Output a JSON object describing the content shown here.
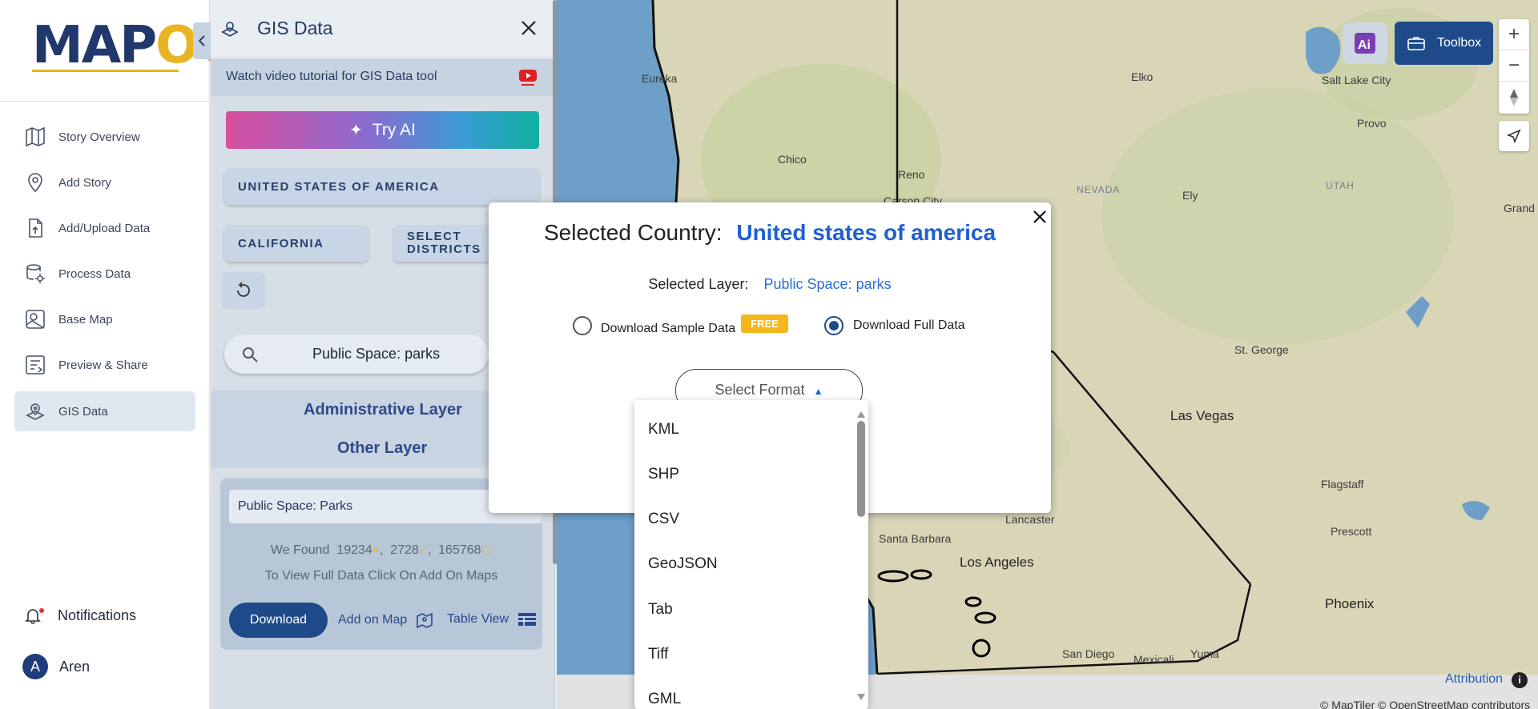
{
  "logo": {
    "text_main": "MAP",
    "text_accent": "OG"
  },
  "nav": {
    "items": [
      {
        "label": "Story Overview",
        "icon": "map-book-icon"
      },
      {
        "label": "Add Story",
        "icon": "location-pin-icon"
      },
      {
        "label": "Add/Upload Data",
        "icon": "file-upload-icon"
      },
      {
        "label": "Process Data",
        "icon": "process-gear-icon"
      },
      {
        "label": "Base Map",
        "icon": "base-map-icon"
      },
      {
        "label": "Preview & Share",
        "icon": "preview-share-icon"
      },
      {
        "label": "GIS Data",
        "icon": "gis-data-icon"
      }
    ],
    "active": "GIS Data",
    "notifications_label": "Notifications",
    "user_initial": "A",
    "user_name": "Aren"
  },
  "gis_panel": {
    "title": "GIS Data",
    "tutorial_text": "Watch video tutorial for GIS Data tool",
    "try_ai_label": "Try AI",
    "country_btn": "UNITED STATES OF AMERICA",
    "state_btn": "CALIFORNIA",
    "districts_btn_line1": "SELECT",
    "districts_btn_line2": "DISTRICTS",
    "search_value": "Public Space: parks",
    "admin_layer_label": "Administrative Layer",
    "other_layer_label": "Other Layer",
    "card": {
      "name": "Public Space: Parks",
      "found_prefix": "We Found",
      "count_points": "19234",
      "count_lines": "2728",
      "count_polygons": "165768",
      "info": "To View Full Data Click On Add On Maps",
      "download_label": "Download",
      "add_map_label": "Add on Map",
      "table_view_label": "Table View"
    }
  },
  "map": {
    "cities": {
      "eureka": "Eureka",
      "chico": "Chico",
      "reno": "Reno",
      "carson": "Carson City",
      "elko": "Elko",
      "slc": "Salt Lake City",
      "provo": "Provo",
      "ely": "Ely",
      "grand": "Grand",
      "stgeorge": "St. George",
      "lasvegas": "Las Vegas",
      "flagstaff": "Flagstaff",
      "lancaster": "Lancaster",
      "santabarbara": "Santa Barbara",
      "losangeles": "Los Angeles",
      "prescott": "Prescott",
      "phoenix": "Phoenix",
      "sandiego": "San Diego",
      "mexicali": "Mexicali",
      "yuma": "Yuma"
    },
    "states": {
      "nevada": "NEVADA",
      "utah": "UTAH"
    },
    "toolbox_label": "Toolbox",
    "zoom_in": "+",
    "zoom_out": "−",
    "attribution": "Attribution",
    "copyright": "© MapTiler © OpenStreetMap contributors",
    "water_color": "#6e9fc9",
    "land_color": "#d9d6b8"
  },
  "modal": {
    "country_label": "Selected Country:",
    "country_value": "United states of america",
    "layer_label": "Selected Layer:",
    "layer_value": "Public Space: parks",
    "sample_label": "Download Sample Data",
    "free_badge": "FREE",
    "full_label": "Download Full Data",
    "selected_option": "Download Full Data",
    "format_placeholder": "Select Format",
    "link_fragment": "es"
  },
  "format_dropdown": {
    "options": [
      "KML",
      "SHP",
      "CSV",
      "GeoJSON",
      "Tab",
      "Tiff",
      "GML"
    ]
  }
}
